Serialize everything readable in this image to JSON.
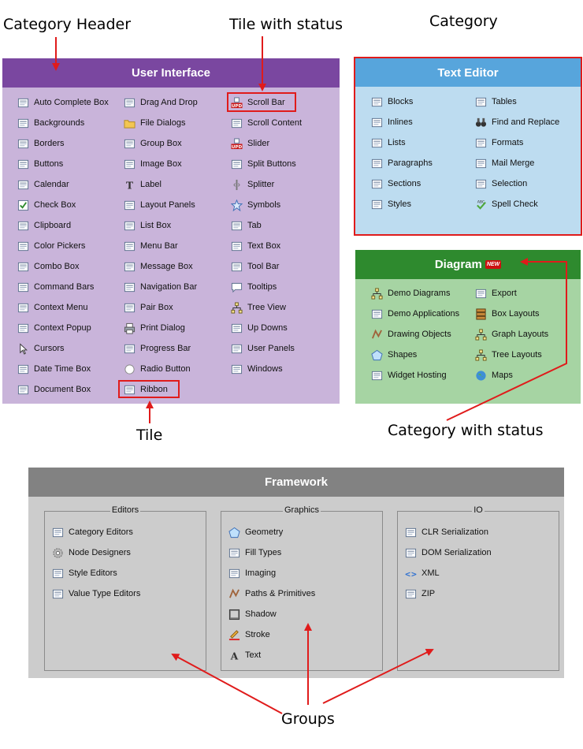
{
  "callouts": {
    "category_header": "Category Header",
    "tile_with_status": "Tile with status",
    "category": "Category",
    "tile": "Tile",
    "category_with_status": "Category with status",
    "groups": "Groups"
  },
  "colors": {
    "ui_header": "#7a47a0",
    "ui_body": "#c9b4da",
    "te_header": "#57a5dc",
    "te_body": "#bddcf0",
    "dg_header": "#2e8a2e",
    "dg_body": "#a6d4a3",
    "fw_header": "#828282",
    "fw_body": "#cccccc",
    "highlight": "#e01b1b"
  },
  "user_interface": {
    "title": "User Interface",
    "columns": [
      [
        {
          "label": "Auto Complete Box",
          "icon": "auto-complete-box-icon"
        },
        {
          "label": "Backgrounds",
          "icon": "backgrounds-icon"
        },
        {
          "label": "Borders",
          "icon": "borders-icon"
        },
        {
          "label": "Buttons",
          "icon": "buttons-icon"
        },
        {
          "label": "Calendar",
          "icon": "calendar-icon"
        },
        {
          "label": "Check Box",
          "icon": "check-box-icon"
        },
        {
          "label": "Clipboard",
          "icon": "clipboard-icon"
        },
        {
          "label": "Color Pickers",
          "icon": "color-pickers-icon"
        },
        {
          "label": "Combo Box",
          "icon": "combo-box-icon"
        },
        {
          "label": "Command Bars",
          "icon": "command-bars-icon"
        },
        {
          "label": "Context Menu",
          "icon": "context-menu-icon"
        },
        {
          "label": "Context Popup",
          "icon": "context-popup-icon"
        },
        {
          "label": "Cursors",
          "icon": "cursor-icon"
        },
        {
          "label": "Date Time Box",
          "icon": "date-time-box-icon"
        },
        {
          "label": "Document Box",
          "icon": "document-box-icon"
        }
      ],
      [
        {
          "label": "Drag And Drop",
          "icon": "drag-and-drop-icon"
        },
        {
          "label": "File Dialogs",
          "icon": "folder-icon"
        },
        {
          "label": "Group Box",
          "icon": "group-box-icon"
        },
        {
          "label": "Image Box",
          "icon": "image-box-icon"
        },
        {
          "label": "Label",
          "icon": "label-icon"
        },
        {
          "label": "Layout Panels",
          "icon": "layout-panels-icon"
        },
        {
          "label": "List Box",
          "icon": "list-box-icon"
        },
        {
          "label": "Menu Bar",
          "icon": "menu-bar-icon"
        },
        {
          "label": "Message Box",
          "icon": "message-box-icon"
        },
        {
          "label": "Navigation Bar",
          "icon": "navigation-bar-icon"
        },
        {
          "label": "Pair Box",
          "icon": "pair-box-icon"
        },
        {
          "label": "Print Dialog",
          "icon": "printer-icon"
        },
        {
          "label": "Progress Bar",
          "icon": "progress-bar-icon"
        },
        {
          "label": "Radio Button",
          "icon": "radio-button-icon"
        },
        {
          "label": "Ribbon",
          "icon": "ribbon-icon"
        }
      ],
      [
        {
          "label": "Scroll Bar",
          "icon": "scroll-bar-icon",
          "badge": "UPD"
        },
        {
          "label": "Scroll Content",
          "icon": "scroll-content-icon"
        },
        {
          "label": "Slider",
          "icon": "slider-icon",
          "badge": "UPD"
        },
        {
          "label": "Split Buttons",
          "icon": "split-buttons-icon"
        },
        {
          "label": "Splitter",
          "icon": "splitter-icon"
        },
        {
          "label": "Symbols",
          "icon": "star-icon"
        },
        {
          "label": "Tab",
          "icon": "tab-icon"
        },
        {
          "label": "Text Box",
          "icon": "text-box-icon"
        },
        {
          "label": "Tool Bar",
          "icon": "tool-bar-icon"
        },
        {
          "label": "Tooltips",
          "icon": "tooltip-icon"
        },
        {
          "label": "Tree View",
          "icon": "tree-view-icon"
        },
        {
          "label": "Up Downs",
          "icon": "up-downs-icon"
        },
        {
          "label": "User Panels",
          "icon": "user-panels-icon"
        },
        {
          "label": "Windows",
          "icon": "windows-icon"
        }
      ]
    ]
  },
  "text_editor": {
    "title": "Text Editor",
    "columns": [
      [
        {
          "label": "Blocks",
          "icon": "blocks-icon"
        },
        {
          "label": "Inlines",
          "icon": "inlines-icon"
        },
        {
          "label": "Lists",
          "icon": "lists-icon"
        },
        {
          "label": "Paragraphs",
          "icon": "paragraphs-icon"
        },
        {
          "label": "Sections",
          "icon": "sections-icon"
        },
        {
          "label": "Styles",
          "icon": "styles-icon"
        }
      ],
      [
        {
          "label": "Tables",
          "icon": "tables-icon"
        },
        {
          "label": "Find and Replace",
          "icon": "binoculars-icon"
        },
        {
          "label": "Formats",
          "icon": "formats-icon"
        },
        {
          "label": "Mail Merge",
          "icon": "mail-merge-icon"
        },
        {
          "label": "Selection",
          "icon": "selection-icon"
        },
        {
          "label": "Spell Check",
          "icon": "spell-check-icon"
        }
      ]
    ]
  },
  "diagram": {
    "title": "Diagram",
    "badge": "NEW",
    "columns": [
      [
        {
          "label": "Demo Diagrams",
          "icon": "demo-diagrams-icon"
        },
        {
          "label": "Demo Applications",
          "icon": "demo-applications-icon"
        },
        {
          "label": "Drawing Objects",
          "icon": "drawing-objects-icon"
        },
        {
          "label": "Shapes",
          "icon": "pentagon-icon"
        },
        {
          "label": "Widget Hosting",
          "icon": "widget-hosting-icon"
        }
      ],
      [
        {
          "label": "Export",
          "icon": "export-icon"
        },
        {
          "label": "Box Layouts",
          "icon": "box-layouts-icon"
        },
        {
          "label": "Graph Layouts",
          "icon": "graph-layouts-icon"
        },
        {
          "label": "Tree Layouts",
          "icon": "tree-layouts-icon"
        },
        {
          "label": "Maps",
          "icon": "globe-icon"
        }
      ]
    ]
  },
  "framework": {
    "title": "Framework",
    "groups": [
      {
        "title": "Editors",
        "items": [
          {
            "label": "Category Editors",
            "icon": "category-editors-icon"
          },
          {
            "label": "Node Designers",
            "icon": "gear-icon"
          },
          {
            "label": "Style Editors",
            "icon": "style-editors-icon"
          },
          {
            "label": "Value Type Editors",
            "icon": "value-type-editors-icon"
          }
        ]
      },
      {
        "title": "Graphics",
        "items": [
          {
            "label": "Geometry",
            "icon": "pentagon-icon"
          },
          {
            "label": "Fill Types",
            "icon": "fill-types-icon"
          },
          {
            "label": "Imaging",
            "icon": "imaging-icon"
          },
          {
            "label": "Paths & Primitives",
            "icon": "paths-icon"
          },
          {
            "label": "Shadow",
            "icon": "shadow-icon"
          },
          {
            "label": "Stroke",
            "icon": "stroke-icon"
          },
          {
            "label": "Text",
            "icon": "text-icon"
          }
        ]
      },
      {
        "title": "IO",
        "items": [
          {
            "label": "CLR Serialization",
            "icon": "clr-serialization-icon"
          },
          {
            "label": "DOM Serialization",
            "icon": "dom-serialization-icon"
          },
          {
            "label": "XML",
            "icon": "xml-icon"
          },
          {
            "label": "ZIP",
            "icon": "zip-icon"
          }
        ]
      }
    ]
  }
}
